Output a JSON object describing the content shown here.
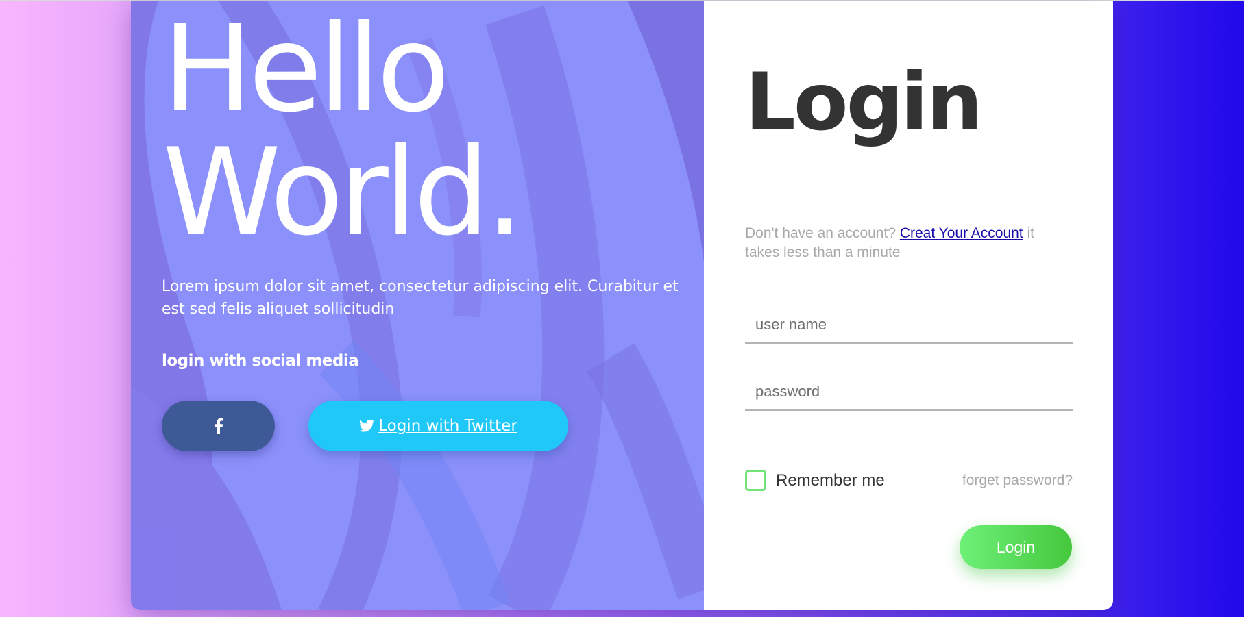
{
  "colors": {
    "left_panel": "#8b90fa",
    "facebook": "#3d5a96",
    "twitter": "#1fc8f7",
    "login_button": "#45c83d",
    "checkbox_border": "#70e37a",
    "link": "#1a0dab"
  },
  "hero": {
    "line1": "Hello",
    "line2": "World.",
    "description": "Lorem ipsum dolor sit amet, consectetur adipiscing elit. Curabitur et est sed felis aliquet sollicitudin",
    "social_title": "login with social media",
    "facebook_icon": "facebook-icon",
    "twitter_icon": "twitter-icon",
    "twitter_label": "Login with Twitter"
  },
  "form": {
    "title": "Login",
    "signup_prefix": "Don't have an account?",
    "signup_link": "Creat Your Account",
    "signup_suffix": "it takes less than a minute",
    "username_placeholder": "user name",
    "password_placeholder": "password",
    "remember_label": "Remember me",
    "forget_label": "forget password?",
    "submit_label": "Login"
  }
}
